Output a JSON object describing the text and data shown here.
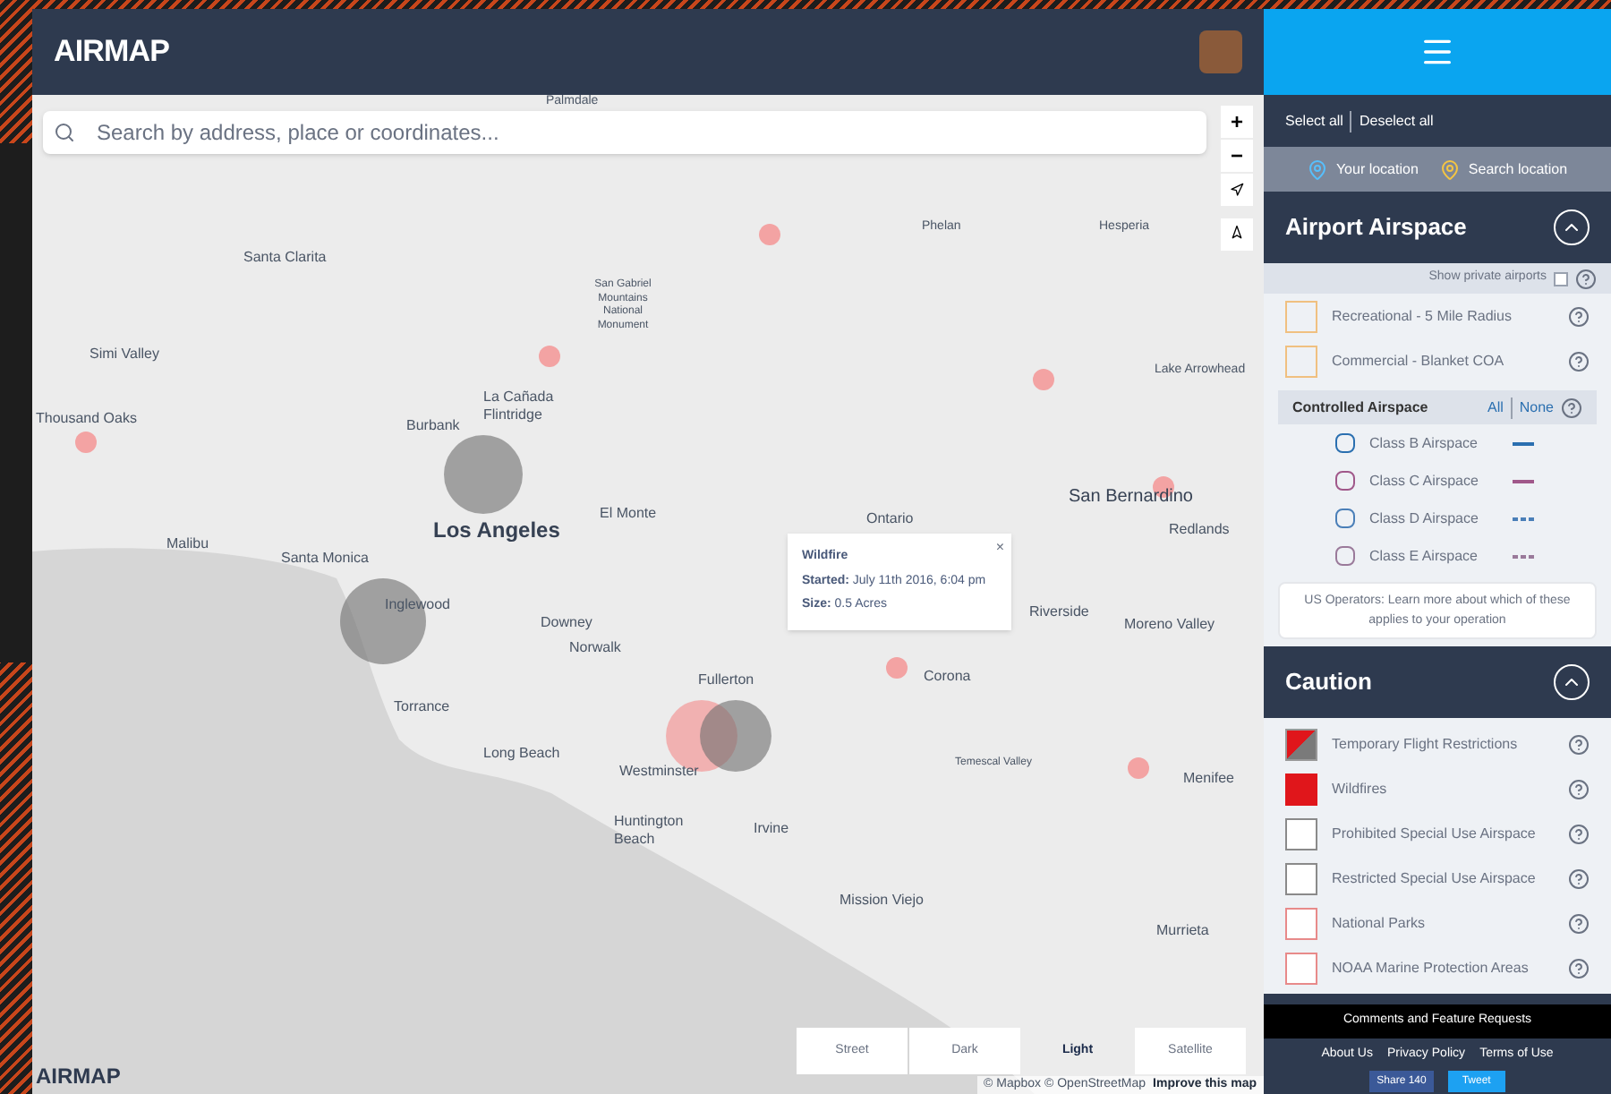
{
  "header": {
    "logo": "AIRMAP"
  },
  "search": {
    "placeholder": "Search by address, place or coordinates..."
  },
  "zoom_controls": [
    "+",
    "−"
  ],
  "map_labels": [
    "Palmdale",
    "Phelan",
    "Hesperia",
    "Santa Clarita",
    "San Gabriel Mountains National Monument",
    "Lake Arrowhead",
    "Simi Valley",
    "Thousand Oaks",
    "La Cañada Flintridge",
    "Burbank",
    "San Bernardino",
    "Ontario",
    "El Monte",
    "Los Angeles",
    "Redlands",
    "Malibu",
    "Santa Monica",
    "Inglewood",
    "Riverside",
    "Downey",
    "Moreno Valley",
    "Norwalk",
    "Fullerton",
    "Corona",
    "Torrance",
    "Temescal Valley",
    "Long Beach",
    "Westminster",
    "Menifee",
    "Huntington Beach",
    "Irvine",
    "Mission Viejo",
    "Murrieta"
  ],
  "popup": {
    "title": "Wildfire",
    "lines": [
      "**Started:** July 11th 2016, 6:04 pm",
      "**Size:** 0.5 Acres"
    ],
    "close": "×"
  },
  "map_styles": [
    {
      "label": "Street",
      "selected": false
    },
    {
      "label": "Dark",
      "selected": false
    },
    {
      "label": "Light",
      "selected": true
    },
    {
      "label": "Satellite",
      "selected": false
    }
  ],
  "attribution": {
    "text": "© Mapbox © OpenStreetMap",
    "link": "Improve this map"
  },
  "map_logo": "AIRMAP",
  "sidebar": {
    "select_links": [
      "Select all",
      "Deselect all"
    ],
    "locations": [
      {
        "label": "Your location",
        "selected": true
      },
      {
        "label": "Search location",
        "selected": false
      }
    ],
    "airport": {
      "title": "Airport Airspace",
      "expanded": true,
      "private_label": "Show private airports",
      "private_checked": false,
      "items": [
        {
          "label": "Recreational - 5 Mile Radius",
          "color": "#f0c080"
        },
        {
          "label": "Commercial - Blanket COA",
          "color": "#f0c080"
        }
      ],
      "controlled": {
        "title": "Controlled Airspace",
        "all": "All",
        "none": "None",
        "items": [
          {
            "label": "Class B Airspace",
            "color": "#2a6fb0",
            "kind": "solid"
          },
          {
            "label": "Class C Airspace",
            "color": "#a0588a",
            "kind": "solid"
          },
          {
            "label": "Class D Airspace",
            "color": "#4a7fb8",
            "kind": "dashed"
          },
          {
            "label": "Class E Airspace",
            "color": "#9a7a9a",
            "kind": "dashed"
          }
        ]
      },
      "note": "US Operators: Learn more about which of these applies to your operation"
    },
    "caution": {
      "title": "Caution",
      "expanded": true,
      "items": [
        {
          "label": "Temporary Flight Restrictions",
          "kind": "split",
          "color": "#e0161b"
        },
        {
          "label": "Wildfires",
          "kind": "filled",
          "color": "#e0161b"
        },
        {
          "label": "Prohibited Special Use Airspace",
          "kind": "outline",
          "color": "#8a8a8a"
        },
        {
          "label": "Restricted Special Use Airspace",
          "kind": "outline",
          "color": "#8a8a8a"
        },
        {
          "label": "National Parks",
          "kind": "outline",
          "color": "#e88a8a"
        },
        {
          "label": "NOAA Marine Protection Areas",
          "kind": "outline",
          "color": "#e88a8a"
        }
      ]
    },
    "footer": {
      "comments": "Comments and Feature Requests",
      "links": [
        "About Us",
        "Privacy Policy",
        "Terms of Use"
      ],
      "share": "Share 140",
      "tweet": "Tweet"
    }
  }
}
